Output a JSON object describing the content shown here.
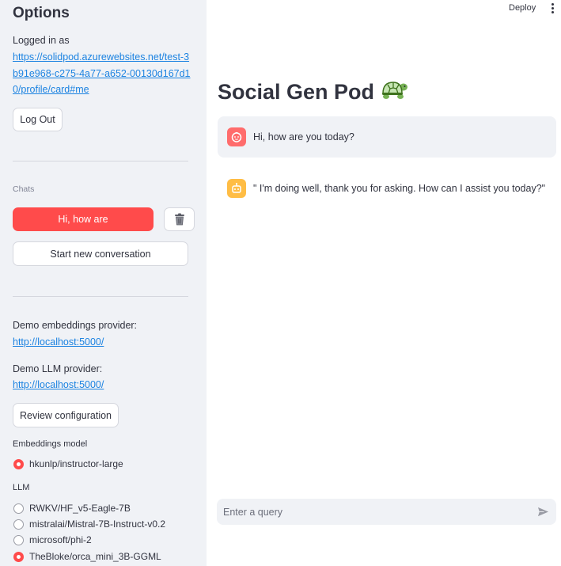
{
  "sidebar": {
    "title": "Options",
    "logged_in_label": "Logged in as",
    "profile_link": "https://solidpod.azurewebsites.net/test-3b91e968-c275-4a77-a652-00130d167d10/profile/card#me",
    "logout_label": "Log Out",
    "chats_caption": "Chats",
    "chat_item_label": "Hi, how are",
    "new_conversation_label": "Start new conversation",
    "embeddings_provider_label": "Demo embeddings provider:",
    "embeddings_provider_link": "http://localhost:5000/",
    "llm_provider_label": "Demo LLM provider:",
    "llm_provider_link": "http://localhost:5000/",
    "review_config_label": "Review configuration",
    "embeddings_model_label": "Embeddings model",
    "embeddings_models": [
      {
        "label": "hkunlp/instructor-large",
        "selected": true
      }
    ],
    "llm_label": "LLM",
    "llm_options": [
      {
        "label": "RWKV/HF_v5-Eagle-7B",
        "selected": false
      },
      {
        "label": "mistralai/Mistral-7B-Instruct-v0.2",
        "selected": false
      },
      {
        "label": "microsoft/phi-2",
        "selected": false
      },
      {
        "label": "TheBloke/orca_mini_3B-GGML",
        "selected": true
      }
    ]
  },
  "header": {
    "deploy_label": "Deploy"
  },
  "main": {
    "title": "Social Gen Pod",
    "title_emoji": "🐢",
    "messages": [
      {
        "role": "user",
        "text": "Hi, how are you today?"
      },
      {
        "role": "assistant",
        "text": "\" I'm doing well, thank you for asking. How can I assist you today?\""
      }
    ],
    "input_placeholder": "Enter a query"
  },
  "colors": {
    "accent": "#ff4b4b",
    "sidebar_bg": "#f0f2f6",
    "link": "#1c83e1",
    "user_avatar": "#ff6c6c",
    "bot_avatar": "#ffbd45"
  }
}
